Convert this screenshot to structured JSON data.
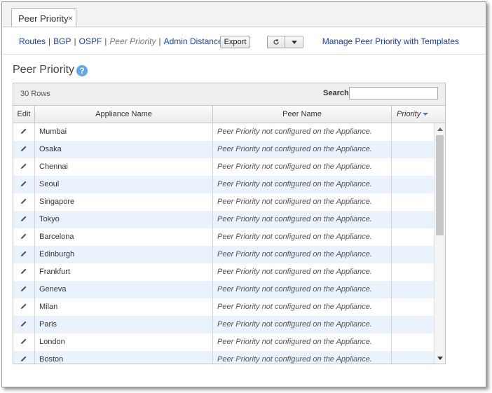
{
  "tab": {
    "label": "Peer Priority",
    "close_glyph": "×"
  },
  "nav": {
    "items": [
      {
        "label": "Routes",
        "current": false
      },
      {
        "label": "BGP",
        "current": false
      },
      {
        "label": "OSPF",
        "current": false
      },
      {
        "label": "Peer Priority",
        "current": true
      },
      {
        "label": "Admin Distance",
        "current": false
      }
    ],
    "separator": "|"
  },
  "toolbar": {
    "export_label": "Export",
    "refresh_icon": "refresh-icon",
    "dropdown_icon": "caret-down-icon"
  },
  "manage_link": "Manage Peer Priority with Templates",
  "page_title": "Peer Priority",
  "help_glyph": "?",
  "grid": {
    "row_count": "30 Rows",
    "search_label": "Search",
    "search_value": "",
    "columns": {
      "edit": "Edit",
      "appliance": "Appliance Name",
      "peer": "Peer Name",
      "priority": "Priority"
    },
    "rows": [
      {
        "appliance": "Mumbai",
        "peer": "Peer Priority not configured on the Appliance.",
        "priority": ""
      },
      {
        "appliance": "Osaka",
        "peer": "Peer Priority not configured on the Appliance.",
        "priority": ""
      },
      {
        "appliance": "Chennai",
        "peer": "Peer Priority not configured on the Appliance.",
        "priority": ""
      },
      {
        "appliance": "Seoul",
        "peer": "Peer Priority not configured on the Appliance.",
        "priority": ""
      },
      {
        "appliance": "Singapore",
        "peer": "Peer Priority not configured on the Appliance.",
        "priority": ""
      },
      {
        "appliance": "Tokyo",
        "peer": "Peer Priority not configured on the Appliance.",
        "priority": ""
      },
      {
        "appliance": "Barcelona",
        "peer": "Peer Priority not configured on the Appliance.",
        "priority": ""
      },
      {
        "appliance": "Edinburgh",
        "peer": "Peer Priority not configured on the Appliance.",
        "priority": ""
      },
      {
        "appliance": "Frankfurt",
        "peer": "Peer Priority not configured on the Appliance.",
        "priority": ""
      },
      {
        "appliance": "Geneva",
        "peer": "Peer Priority not configured on the Appliance.",
        "priority": ""
      },
      {
        "appliance": "Milan",
        "peer": "Peer Priority not configured on the Appliance.",
        "priority": ""
      },
      {
        "appliance": "Paris",
        "peer": "Peer Priority not configured on the Appliance.",
        "priority": ""
      },
      {
        "appliance": "London",
        "peer": "Peer Priority not configured on the Appliance.",
        "priority": ""
      },
      {
        "appliance": "Boston",
        "peer": "Peer Priority not configured on the Appliance.",
        "priority": ""
      }
    ]
  },
  "colors": {
    "link": "#1a3fae",
    "alt_row": "#eaf3fd",
    "help_badge": "#64a7e6",
    "sort_arrow": "#3d7bd1"
  }
}
